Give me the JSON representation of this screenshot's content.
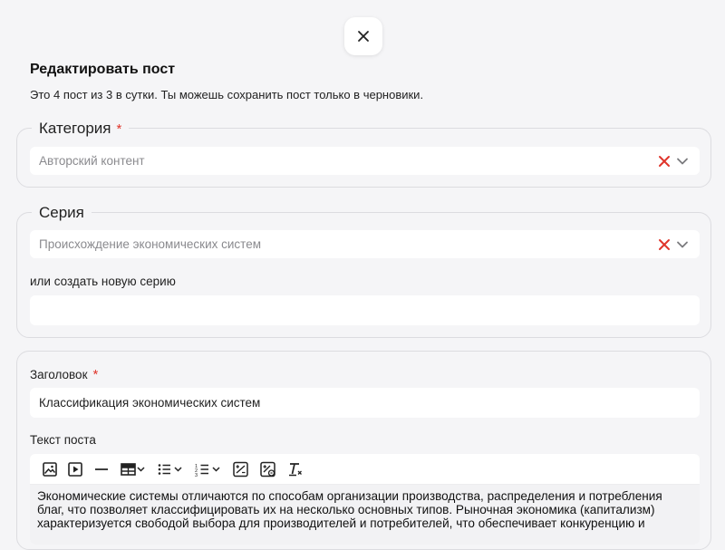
{
  "modal": {
    "title": "Редактировать пост",
    "subtitle": "Это 4 пост из 3 в сутки. Ты можешь сохранить пост только в черновики."
  },
  "category": {
    "legend": "Категория",
    "required_mark": "*",
    "value": "Авторский контент"
  },
  "series": {
    "legend": "Серия",
    "value": "Происхождение экономических систем",
    "new_series_label": "или создать новую серию",
    "new_series_value": ""
  },
  "post": {
    "title_label": "Заголовок",
    "required_mark": "*",
    "title_value": "Классификация экономических систем",
    "body_label": "Текст поста",
    "body_text": "Экономические системы отличаются по способам организации производства, распределения и потребления благ, что позволяет классифицировать их на несколько основных типов. Рыночная экономика (капитализм) характеризуется свободой выбора для производителей и потребителей, что обеспечивает конкуренцию и"
  },
  "toolbar": {
    "items": [
      "image-icon",
      "video-icon",
      "horizontal-rule-icon",
      "table-icon",
      "bullet-list-icon",
      "numbered-list-icon",
      "formula-icon",
      "formula-block-icon",
      "clear-format-icon"
    ]
  },
  "colors": {
    "clear_x": "#e0352b",
    "required": "#e0352b",
    "background": "#f5f5f7"
  }
}
